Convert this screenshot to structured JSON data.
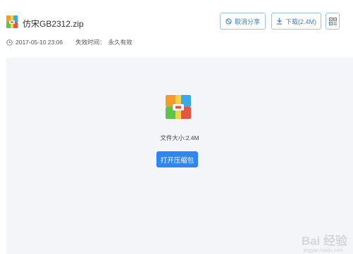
{
  "file": {
    "name": "仿宋GB2312.zip",
    "icon": "zip-archive-icon"
  },
  "meta": {
    "date": "2017-05-10 23:06",
    "expiry_label": "失效时间：",
    "expiry_value": "永久有效"
  },
  "actions": {
    "cancel_share": "取消分享",
    "download": "下载(2.4M)"
  },
  "preview": {
    "size_text": "文件大小:2.4M",
    "open_button": "打开压缩包"
  },
  "watermark": {
    "text": "Bai 经验",
    "sub": "jingyan.baidu.com"
  },
  "colors": {
    "accent": "#2f86f0",
    "button_border": "#9cc2ee",
    "preview_bg": "#f4f5f8"
  }
}
